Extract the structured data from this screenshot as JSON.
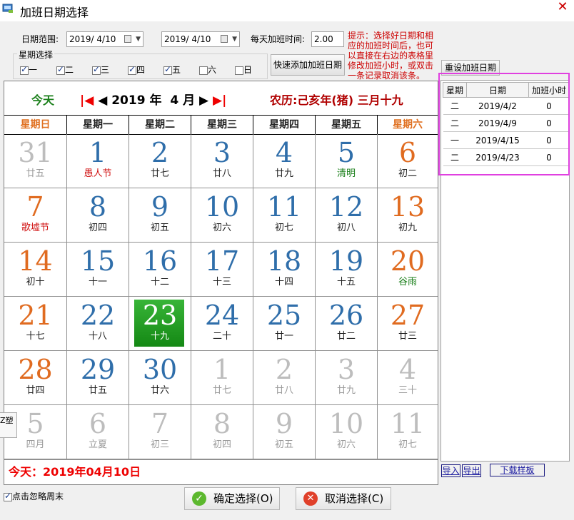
{
  "window": {
    "title": "加班日期选择",
    "close_glyph": "✕"
  },
  "filters": {
    "range_label": "日期范围:",
    "date_from": "2019/ 4/10",
    "date_to": "2019/ 4/10",
    "hours_label": "每天加班时间:",
    "hours_value": "2.00",
    "weekday_label": "星期选择",
    "weekdays": [
      {
        "label": "一",
        "checked": true
      },
      {
        "label": "二",
        "checked": true
      },
      {
        "label": "三",
        "checked": true
      },
      {
        "label": "四",
        "checked": true
      },
      {
        "label": "五",
        "checked": true
      },
      {
        "label": "六",
        "checked": false
      },
      {
        "label": "日",
        "checked": false
      }
    ],
    "quick_add_label": "快速添加加班日期",
    "hint": "提示：选择好日期和相应的加班时间后，也可以直接在右边的表格里修改加班小时，或双击一条记录取消该条。"
  },
  "calendar": {
    "today_link": "今天",
    "year": "2019",
    "year_unit": "年",
    "month": "4",
    "month_unit": "月",
    "lunar_header": "农历:己亥年(猪) 三月十九",
    "weekday_headers": [
      "星期日",
      "星期一",
      "星期二",
      "星期三",
      "星期四",
      "星期五",
      "星期六"
    ],
    "weeks": [
      [
        {
          "d": "31",
          "l": "廿五",
          "t": "oth"
        },
        {
          "d": "1",
          "l": "愚人节",
          "t": "fest"
        },
        {
          "d": "2",
          "l": "廿七"
        },
        {
          "d": "3",
          "l": "廿八"
        },
        {
          "d": "4",
          "l": "廿九"
        },
        {
          "d": "5",
          "l": "清明",
          "t": "term"
        },
        {
          "d": "6",
          "l": "初二"
        }
      ],
      [
        {
          "d": "7",
          "l": "歌墟节",
          "t": "fest"
        },
        {
          "d": "8",
          "l": "初四"
        },
        {
          "d": "9",
          "l": "初五"
        },
        {
          "d": "10",
          "l": "初六"
        },
        {
          "d": "11",
          "l": "初七"
        },
        {
          "d": "12",
          "l": "初八"
        },
        {
          "d": "13",
          "l": "初九"
        }
      ],
      [
        {
          "d": "14",
          "l": "初十"
        },
        {
          "d": "15",
          "l": "十一"
        },
        {
          "d": "16",
          "l": "十二"
        },
        {
          "d": "17",
          "l": "十三"
        },
        {
          "d": "18",
          "l": "十四"
        },
        {
          "d": "19",
          "l": "十五"
        },
        {
          "d": "20",
          "l": "谷雨",
          "t": "term"
        }
      ],
      [
        {
          "d": "21",
          "l": "十七"
        },
        {
          "d": "22",
          "l": "十八"
        },
        {
          "d": "23",
          "l": "十九",
          "t": "today"
        },
        {
          "d": "24",
          "l": "二十"
        },
        {
          "d": "25",
          "l": "廿一"
        },
        {
          "d": "26",
          "l": "廿二"
        },
        {
          "d": "27",
          "l": "廿三"
        }
      ],
      [
        {
          "d": "28",
          "l": "廿四"
        },
        {
          "d": "29",
          "l": "廿五"
        },
        {
          "d": "30",
          "l": "廿六"
        },
        {
          "d": "1",
          "l": "廿七",
          "t": "oth"
        },
        {
          "d": "2",
          "l": "廿八",
          "t": "oth"
        },
        {
          "d": "3",
          "l": "廿九",
          "t": "oth"
        },
        {
          "d": "4",
          "l": "三十",
          "t": "oth"
        }
      ],
      [
        {
          "d": "5",
          "l": "四月",
          "t": "oth"
        },
        {
          "d": "6",
          "l": "立夏",
          "t": "oth"
        },
        {
          "d": "7",
          "l": "初三",
          "t": "oth"
        },
        {
          "d": "8",
          "l": "初四",
          "t": "oth"
        },
        {
          "d": "9",
          "l": "初五",
          "t": "oth"
        },
        {
          "d": "10",
          "l": "初六",
          "t": "oth"
        },
        {
          "d": "11",
          "l": "初七",
          "t": "oth"
        }
      ]
    ],
    "footer_today": "今天：2019年04月10日"
  },
  "right_panel": {
    "reset_label": "重设加班日期",
    "columns": [
      "星期",
      "日期",
      "加班小时"
    ],
    "rows": [
      {
        "weekday": "二",
        "date": "2019/4/2",
        "hours": "0"
      },
      {
        "weekday": "二",
        "date": "2019/4/9",
        "hours": "0"
      },
      {
        "weekday": "一",
        "date": "2019/4/15",
        "hours": "0"
      },
      {
        "weekday": "二",
        "date": "2019/4/23",
        "hours": "0"
      }
    ],
    "import_label": "导入",
    "export_label": "导出",
    "template_label": "下载样板"
  },
  "bottom": {
    "ignore_weekend_label": "点击忽略周末",
    "ignore_weekend_checked": true,
    "ok_label": "确定选择(O)",
    "cancel_label": "取消选择(C)",
    "side_tab_label": "Z塑"
  }
}
